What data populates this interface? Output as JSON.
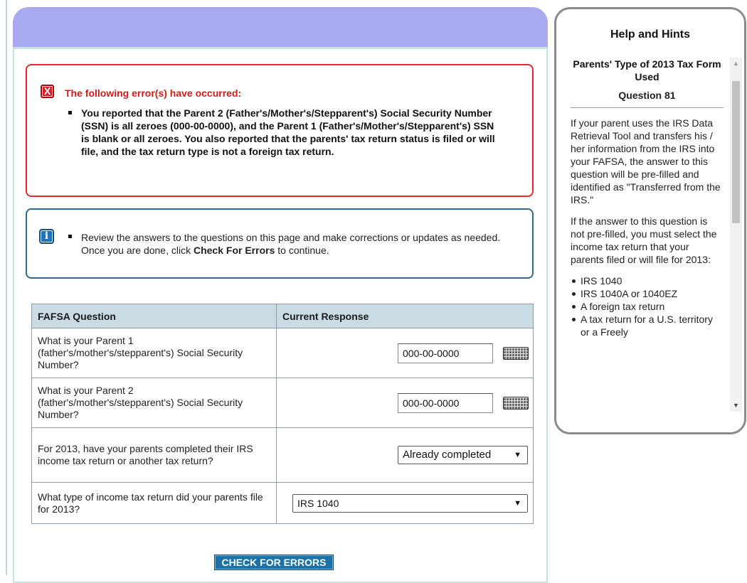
{
  "error_box": {
    "heading": "The following error(s) have occurred:",
    "icon": "error-x-icon",
    "messages": [
      "You reported that the Parent 2 (Father's/Mother's/Stepparent's) Social Security Number (SSN) is all zeroes (000-00-0000), and the Parent 1 (Father's/Mother's/Stepparent's) SSN is blank or all zeroes. You also reported that the parents' tax return status is filed or will file, and the tax return type is not a foreign tax return."
    ]
  },
  "info_box": {
    "icon": "info-icon",
    "text_before": "Review the answers to the questions on this page and make corrections or updates as needed. Once you are done, click ",
    "text_bold": "Check For Errors",
    "text_after": " to continue."
  },
  "table": {
    "headers": [
      "FAFSA Question",
      "Current Response"
    ],
    "rows": [
      {
        "question": "What is your Parent 1 (father's/mother's/stepparent's) Social Security Number?",
        "value": "000-00-0000"
      },
      {
        "question": "What is your Parent 2 (father's/mother's/stepparent's) Social Security Number?",
        "value": "000-00-0000"
      },
      {
        "question": "For 2013, have your parents completed their IRS income tax return or another tax return?",
        "value": "Already completed"
      },
      {
        "question": "What type of income tax return did your parents file for 2013?",
        "value": "IRS 1040"
      }
    ]
  },
  "check_button": "CHECK FOR ERRORS",
  "help": {
    "title": "Help and Hints",
    "subtitle": "Parents' Type of 2013 Tax Form Used",
    "question": "Question 81",
    "paragraph1": "If your parent uses the IRS Data Retrieval Tool and transfers his / her information from the IRS into your FAFSA, the answer to this question will be pre-filled and identified as \"Transferred from the IRS.\"",
    "paragraph2": "If the answer to this question is not pre-filled, you must select the income tax return that your parents filed or will file for 2013:",
    "options": [
      "IRS 1040",
      "IRS 1040A or 1040EZ",
      "A foreign tax return",
      "A tax return for a U.S. territory or a Freely"
    ]
  },
  "colors": {
    "header_band": "#a9a9f0",
    "error_border": "#e32a2a",
    "info_border": "#2a6c8e",
    "button": "#1c72a6"
  }
}
